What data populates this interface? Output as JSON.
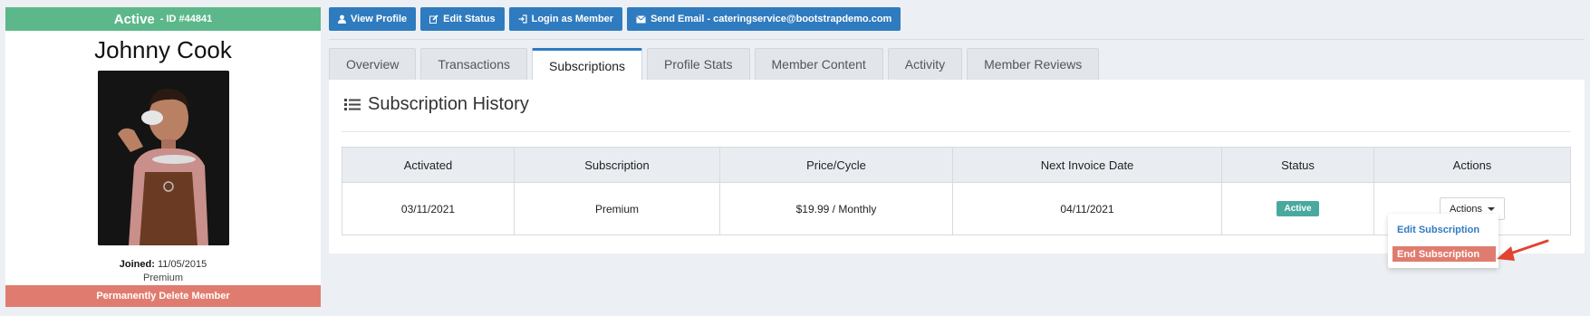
{
  "profile": {
    "status": "Active",
    "id_label": "- ID #44841",
    "name": "Johnny Cook",
    "joined_label": "Joined:",
    "joined_date": "11/05/2015",
    "plan": "Premium",
    "delete_label": "Permanently Delete Member"
  },
  "top_buttons": [
    {
      "label": "View Profile",
      "icon": "user-icon"
    },
    {
      "label": "Edit Status",
      "icon": "edit-icon"
    },
    {
      "label": "Login as Member",
      "icon": "login-icon"
    },
    {
      "label": "Send Email - cateringservice@bootstrapdemo.com",
      "icon": "envelope-icon"
    }
  ],
  "tabs": [
    {
      "label": "Overview",
      "active": false
    },
    {
      "label": "Transactions",
      "active": false
    },
    {
      "label": "Subscriptions",
      "active": true
    },
    {
      "label": "Profile Stats",
      "active": false
    },
    {
      "label": "Member Content",
      "active": false
    },
    {
      "label": "Activity",
      "active": false
    },
    {
      "label": "Member Reviews",
      "active": false
    }
  ],
  "panel": {
    "title": "Subscription History",
    "columns": [
      "Activated",
      "Subscription",
      "Price/Cycle",
      "Next Invoice Date",
      "Status",
      "Actions"
    ],
    "rows": [
      {
        "activated": "03/11/2021",
        "subscription": "Premium",
        "price": "$19.99 / Monthly",
        "next_invoice": "04/11/2021",
        "status": "Active",
        "actions": "Actions"
      }
    ]
  },
  "dropdown": {
    "edit": "Edit Subscription",
    "end": "End Subscription"
  },
  "colors": {
    "active_green": "#5cb88a",
    "primary_blue": "#2f7bbf",
    "danger_red": "#e07c6f",
    "badge_teal": "#4aa99f",
    "arrow_red": "#e2432f"
  }
}
